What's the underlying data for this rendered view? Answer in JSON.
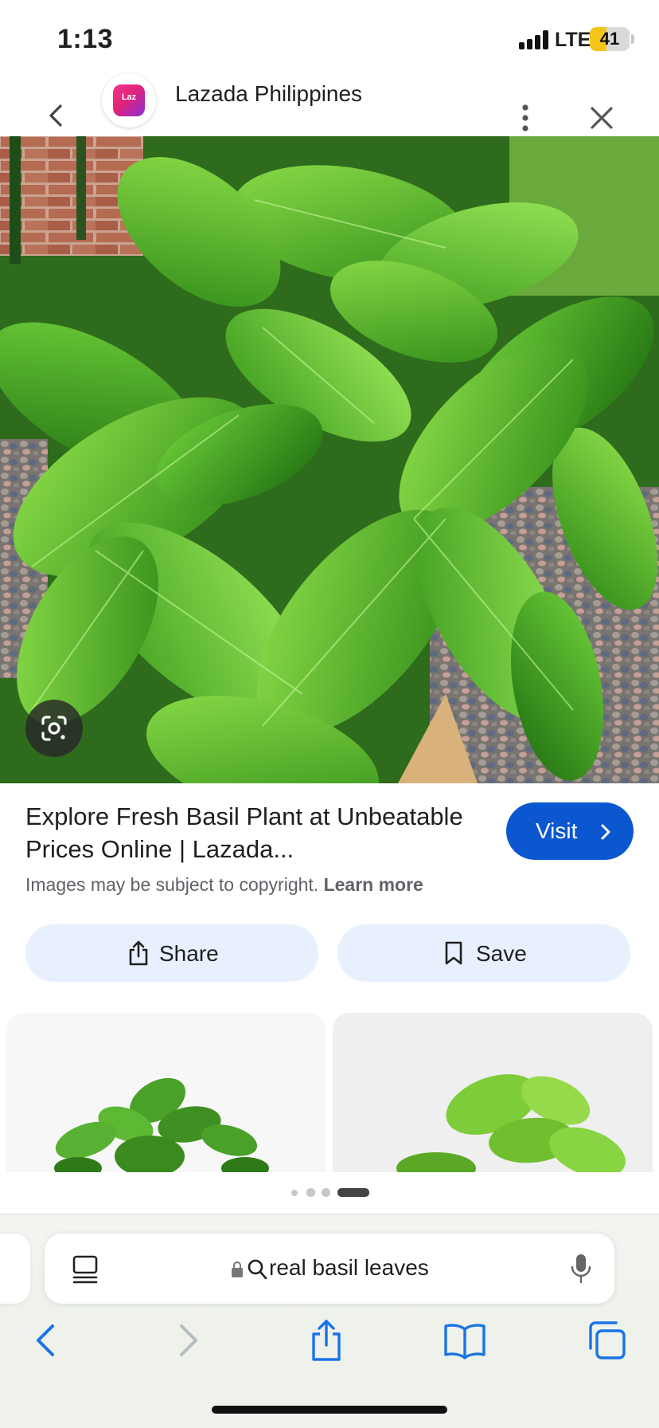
{
  "status_bar": {
    "time": "1:13",
    "network": "LTE",
    "battery_percent": "41",
    "battery_level": 0.41,
    "battery_color": "#f4c518"
  },
  "header": {
    "back_icon": "chevron-left-icon",
    "site_logo_text": "Laz",
    "site_name": "Lazada Philippines",
    "more_icon": "more-vertical-icon",
    "close_icon": "close-icon"
  },
  "image": {
    "lens_icon": "google-lens-icon"
  },
  "result": {
    "title": "Explore Fresh Basil Plant at Unbeatable Prices Online | Lazada...",
    "visit_label": "Visit",
    "copyright_text": "Images may be subject to copyright.",
    "learn_more_label": "Learn more"
  },
  "actions": {
    "share_label": "Share",
    "save_label": "Save"
  },
  "pager": {
    "total": 4,
    "active": 4
  },
  "browser": {
    "search_query": "real basil leaves",
    "tabs_layout_icon": "tab-layout-icon",
    "lock_icon": "lock-icon",
    "mic_icon": "microphone-icon",
    "toolbar": [
      "back-icon",
      "forward-icon",
      "share-icon",
      "bookmarks-icon",
      "tabs-icon"
    ]
  },
  "colors": {
    "accent": "#0b57d0",
    "chip_background": "#e8f0fe",
    "logo_gradient_start": "#f0378e",
    "logo_gradient_end": "#8a2fd6"
  }
}
